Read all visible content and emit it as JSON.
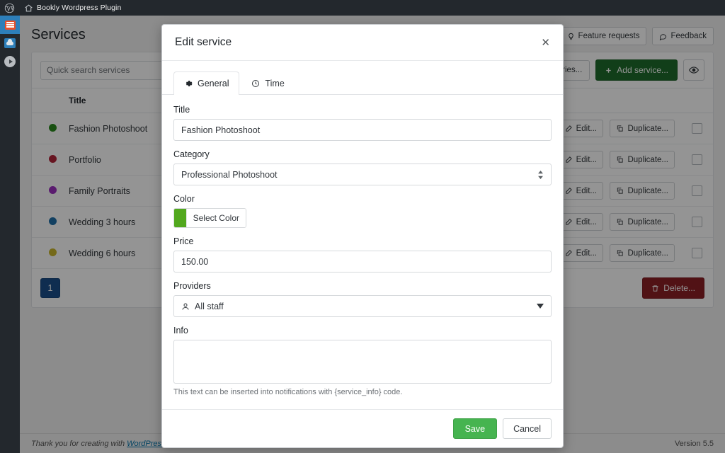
{
  "adminbar": {
    "logo_icon": "wordpress-logo-icon",
    "home_icon": "home-icon",
    "site_name": "Bookly Wordpress Plugin"
  },
  "rail": {
    "items": [
      {
        "icon": "bookly-calendar-icon",
        "active": true
      },
      {
        "icon": "cloud-icon",
        "active": false
      },
      {
        "icon": "play-circle-icon",
        "active": false
      }
    ]
  },
  "page": {
    "title": "Services",
    "header_buttons": [
      {
        "label": "Feature requests",
        "icon": "lightbulb-icon"
      },
      {
        "label": "Feedback",
        "icon": "comment-icon"
      }
    ],
    "search": {
      "placeholder": "Quick search services",
      "value": ""
    },
    "top_actions": [
      {
        "label": "gories...",
        "icon": "",
        "style": "outline"
      },
      {
        "label": "Add service...",
        "icon": "plus-icon",
        "style": "green"
      },
      {
        "label": "",
        "icon": "eye-icon",
        "style": "icon-only"
      }
    ],
    "table": {
      "columns": [
        "",
        "Title",
        "",
        ""
      ],
      "header_title": "Title",
      "row_actions": [
        {
          "label": "Edit...",
          "icon": "edit-icon"
        },
        {
          "label": "Duplicate...",
          "icon": "copy-icon"
        }
      ],
      "rows": [
        {
          "color": "#2a8a1e",
          "title": "Fashion Photoshoot"
        },
        {
          "color": "#b1253a",
          "title": "Portfolio"
        },
        {
          "color": "#9b2fbf",
          "title": "Family Portraits"
        },
        {
          "color": "#1f6fa8",
          "title": "Wedding 3 hours"
        },
        {
          "color": "#c9b62c",
          "title": "Wedding 6 hours"
        }
      ]
    },
    "pagination": {
      "current": "1"
    },
    "delete_button": {
      "label": "Delete...",
      "icon": "trash-icon"
    }
  },
  "footer": {
    "thanks_prefix": "Thank you for creating with ",
    "thanks_link": "WordPress",
    "thanks_suffix": ".",
    "version": "Version 5.5"
  },
  "modal": {
    "title": "Edit service",
    "close_icon": "close-icon",
    "tabs": [
      {
        "label": "General",
        "icon": "gear-icon",
        "active": true
      },
      {
        "label": "Time",
        "icon": "clock-icon",
        "active": false
      }
    ],
    "fields": {
      "title": {
        "label": "Title",
        "value": "Fashion Photoshoot",
        "placeholder": ""
      },
      "category": {
        "label": "Category",
        "value": "Professional Photoshoot"
      },
      "color": {
        "label": "Color",
        "button_label": "Select Color",
        "swatch_hex": "#52a81e"
      },
      "price": {
        "label": "Price",
        "value": "150.00",
        "placeholder": ""
      },
      "providers": {
        "label": "Providers",
        "value": "All staff",
        "icon": "user-icon"
      },
      "info": {
        "label": "Info",
        "value": "",
        "placeholder": "",
        "hint": "This text can be inserted into notifications with {service_info} code."
      }
    },
    "buttons": {
      "save": "Save",
      "cancel": "Cancel"
    }
  },
  "colors": {
    "admin_dark": "#23282d",
    "accent_blue": "#2d7fba",
    "green_primary": "#1e6b2b",
    "green_save": "#46b450",
    "red_delete": "#8c1f25",
    "pager_blue": "#1b4f8a"
  }
}
